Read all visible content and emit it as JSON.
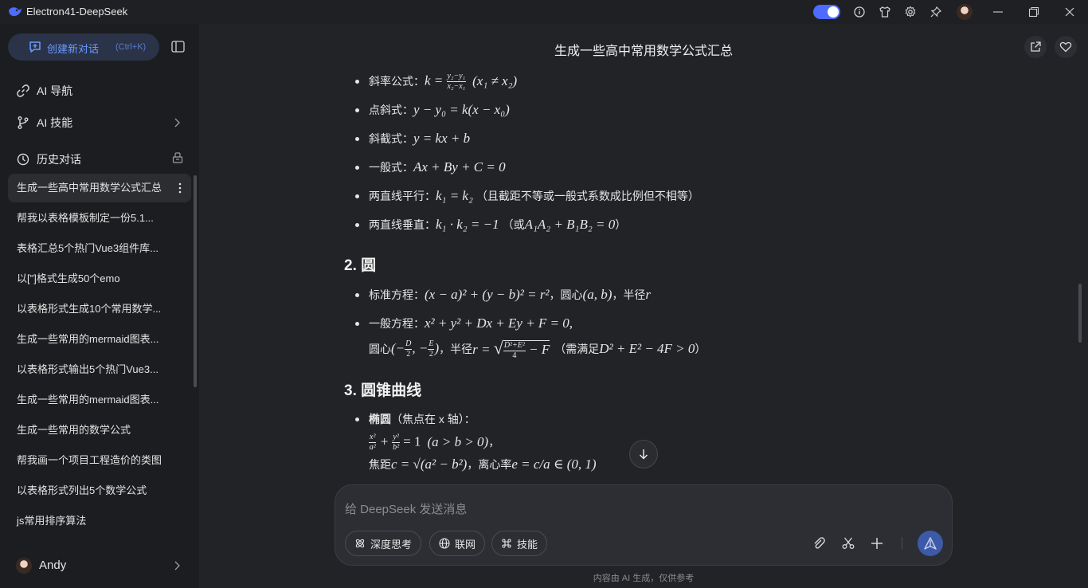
{
  "window": {
    "title": "Electron41-DeepSeek"
  },
  "sidebar": {
    "new_chat": {
      "label": "创建新对话",
      "shortcut": "(Ctrl+K)"
    },
    "nav": [
      {
        "label": "AI 导航",
        "icon": "link-icon"
      },
      {
        "label": "AI 技能",
        "icon": "branch-icon"
      }
    ],
    "history_header": "历史对话",
    "history": [
      "生成一些高中常用数学公式汇总",
      "帮我以表格模板制定一份5.1...",
      "表格汇总5个热门Vue3组件库...",
      "以[\"]格式生成50个emo",
      "以表格形式生成10个常用数学...",
      "生成一些常用的mermaid图表...",
      "以表格形式输出5个热门Vue3...",
      "生成一些常用的mermaid图表...",
      "生成一些常用的数学公式",
      "帮我画一个项目工程造价的类图",
      "以表格形式列出5个数学公式",
      "js常用排序算法"
    ],
    "user": {
      "name": "Andy"
    }
  },
  "main": {
    "chat_title": "生成一些高中常用数学公式汇总",
    "line_items": {
      "slope_label": "斜率公式：",
      "slope_cond": "(x₁ ≠ x₂)",
      "point_slope_label": "点斜式：",
      "point_slope": "y − y₀ = k(x − x₀)",
      "intercept_label": "斜截式：",
      "intercept": "y = kx + b",
      "general_label": "一般式：",
      "general": "Ax + By + C = 0",
      "parallel_label": "两直线平行：",
      "parallel": "k₁ = k₂",
      "parallel_note": "（且截距不等或一般式系数成比例但不相等）",
      "perp_label": "两直线垂直：",
      "perp": "k₁ · k₂ = −1",
      "perp_note_pre": "（或 ",
      "perp_note": "A₁A₂ + B₁B₂ = 0",
      "perp_note_post": "）"
    },
    "section_circle": "2. 圆",
    "circle": {
      "std_label": "标准方程：",
      "std": "(x − a)² + (y − b)² = r²",
      "center_label": "，圆心 ",
      "center": "(a, b)",
      "radius_label": "，半径 ",
      "radius": "r",
      "gen_label": "一般方程：",
      "gen": "x² + y² + Dx + Ey + F = 0,",
      "gen_center_label": "圆心 ",
      "gen_center": "(−D/2, −E/2)",
      "gen_radius_label": "，半径 ",
      "gen_radius": "r = √(D²+E²)/4 − F",
      "gen_cond_pre": "（需满足 ",
      "gen_cond": "D² + E² − 4F > 0",
      "gen_cond_post": "）"
    },
    "section_conic": "3. 圆锥曲线",
    "ellipse": {
      "label": "椭圆",
      "focus_note": "（焦点在 x 轴）：",
      "eq": "x²/a² + y²/b² = 1",
      "cond": "(a > b > 0)",
      "trail": "，",
      "focal_label": "焦距 ",
      "focal": "c = √(a² − b²)",
      "ecc_label": "，离心率 ",
      "ecc": "e = c/a ∈ (0, 1)"
    }
  },
  "composer": {
    "placeholder": "给 DeepSeek 发送消息",
    "buttons": [
      "深度思考",
      "联网",
      "技能"
    ]
  },
  "footer": {
    "disclaimer": "内容由 AI 生成，仅供参考"
  },
  "colors": {
    "accent": "#4d6bfe",
    "background": "#212327",
    "sidebar": "#1c1d20"
  }
}
